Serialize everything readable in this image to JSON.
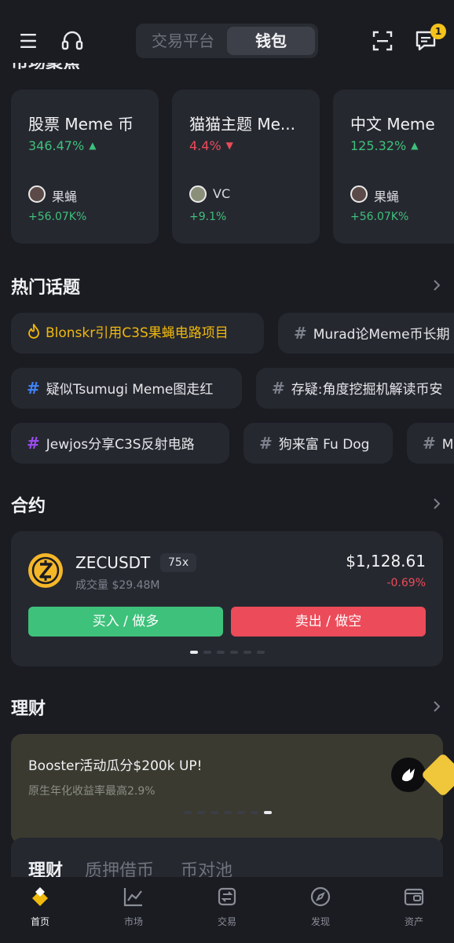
{
  "header": {
    "segments": [
      "交易平台",
      "钱包"
    ],
    "active_segment": "钱包",
    "notification_count": "1",
    "partial_section_title": "市场聚焦"
  },
  "market_focus": {
    "cards": [
      {
        "title": "股票 Meme 币",
        "change": "346.47%",
        "direction": "up",
        "author": "果蝇",
        "author_gain": "+56.07K%"
      },
      {
        "title": "猫猫主题 Me...",
        "change": "4.4%",
        "direction": "down",
        "author": "VC",
        "author_gain": "+9.1%"
      },
      {
        "title": "中文 Meme",
        "change": "125.32%",
        "direction": "up",
        "author": "果蝇",
        "author_gain": "+56.07K%"
      }
    ]
  },
  "hot_topics": {
    "title": "热门话题",
    "rows": [
      [
        {
          "text": "Blonskr引用C3S果蝇电路项目",
          "style": "hot"
        },
        {
          "text": "Murad论Meme币长期",
          "style": "gray"
        }
      ],
      [
        {
          "text": "疑似Tsumugi Meme图走红",
          "style": "blue"
        },
        {
          "text": "存疑:角度挖掘机解读币安",
          "style": "gray"
        }
      ],
      [
        {
          "text": "Jewjos分享C3S反射电路",
          "style": "purple"
        },
        {
          "text": "狗来富 Fu Dog",
          "style": "gray"
        },
        {
          "text": "M",
          "style": "gray"
        }
      ]
    ]
  },
  "contracts": {
    "title": "合约",
    "pair": "ZECUSDT",
    "leverage": "75x",
    "volume": "成交量 $29.48M",
    "price": "$1,128.61",
    "change": "-0.69%",
    "buy_label": "买入 / 做多",
    "sell_label": "卖出 / 做空",
    "page_count": 6,
    "active_page": 0
  },
  "finance": {
    "title": "理财",
    "banner_title": "Booster活动瓜分$200k UP!",
    "banner_subtitle": "原生年化收益率最高2.9%",
    "banner_page_count": 7,
    "banner_active_page": 6,
    "tabs": [
      "理财",
      "质押借币",
      "币对池"
    ],
    "active_tab": "理财"
  },
  "bottom_nav": {
    "items": [
      {
        "label": "首页",
        "icon": "home-icon"
      },
      {
        "label": "市场",
        "icon": "market-chart-icon"
      },
      {
        "label": "交易",
        "icon": "trade-icon"
      },
      {
        "label": "发现",
        "icon": "discover-icon"
      },
      {
        "label": "资产",
        "icon": "wallet-icon"
      }
    ],
    "active": "首页"
  },
  "colors": {
    "up": "#3ec17b",
    "down": "#ec4b59",
    "accent": "#f0b90b",
    "background": "#1b1c22",
    "card": "#262830"
  }
}
